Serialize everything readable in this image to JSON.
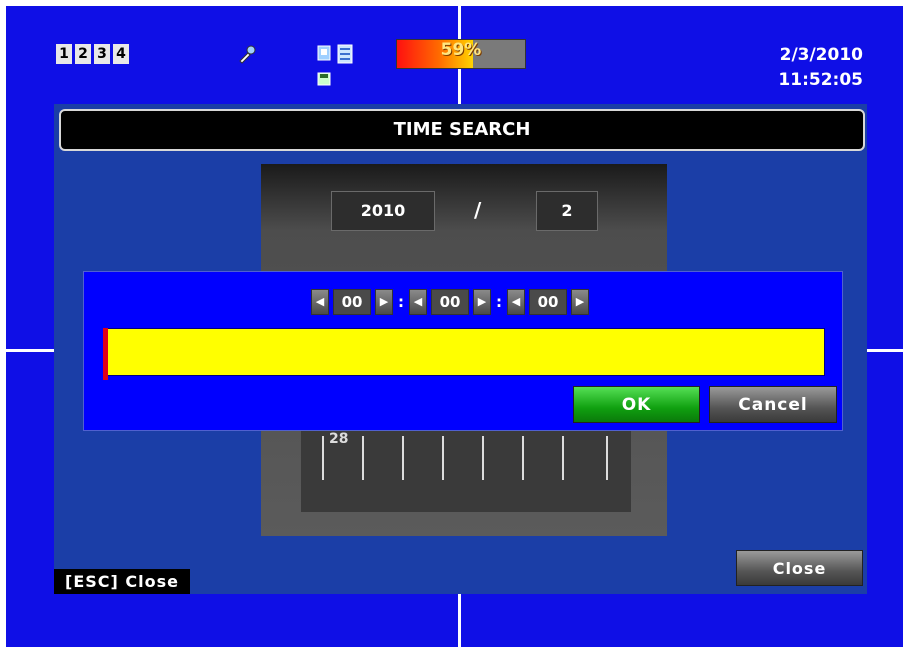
{
  "status_bar": {
    "channels": [
      "1",
      "2",
      "3",
      "4"
    ],
    "hdd_usage_text": "59%",
    "hdd_usage_fraction": 0.59,
    "date": "2/3/2010",
    "time": "11:52:05",
    "icons": [
      "tools-icon",
      "network-icon",
      "disk-icon"
    ]
  },
  "panel": {
    "title": "TIME SEARCH",
    "calendar": {
      "year": "2010",
      "separator": "/",
      "month": "2",
      "visible_day": "28"
    }
  },
  "dialog": {
    "hour": "00",
    "minute": "00",
    "second": "00",
    "colon": ":",
    "ok_label": "OK",
    "cancel_label": "Cancel",
    "colors": {
      "timeline": "#ffff00",
      "cursor": "#e0001a",
      "dialog_bg": "#0000ff"
    }
  },
  "footer": {
    "esc_hint": "[ESC] Close",
    "close_label": "Close"
  },
  "colors": {
    "screen_bg": "#0f0fe6",
    "panel_bg": "#1b3ea7"
  }
}
